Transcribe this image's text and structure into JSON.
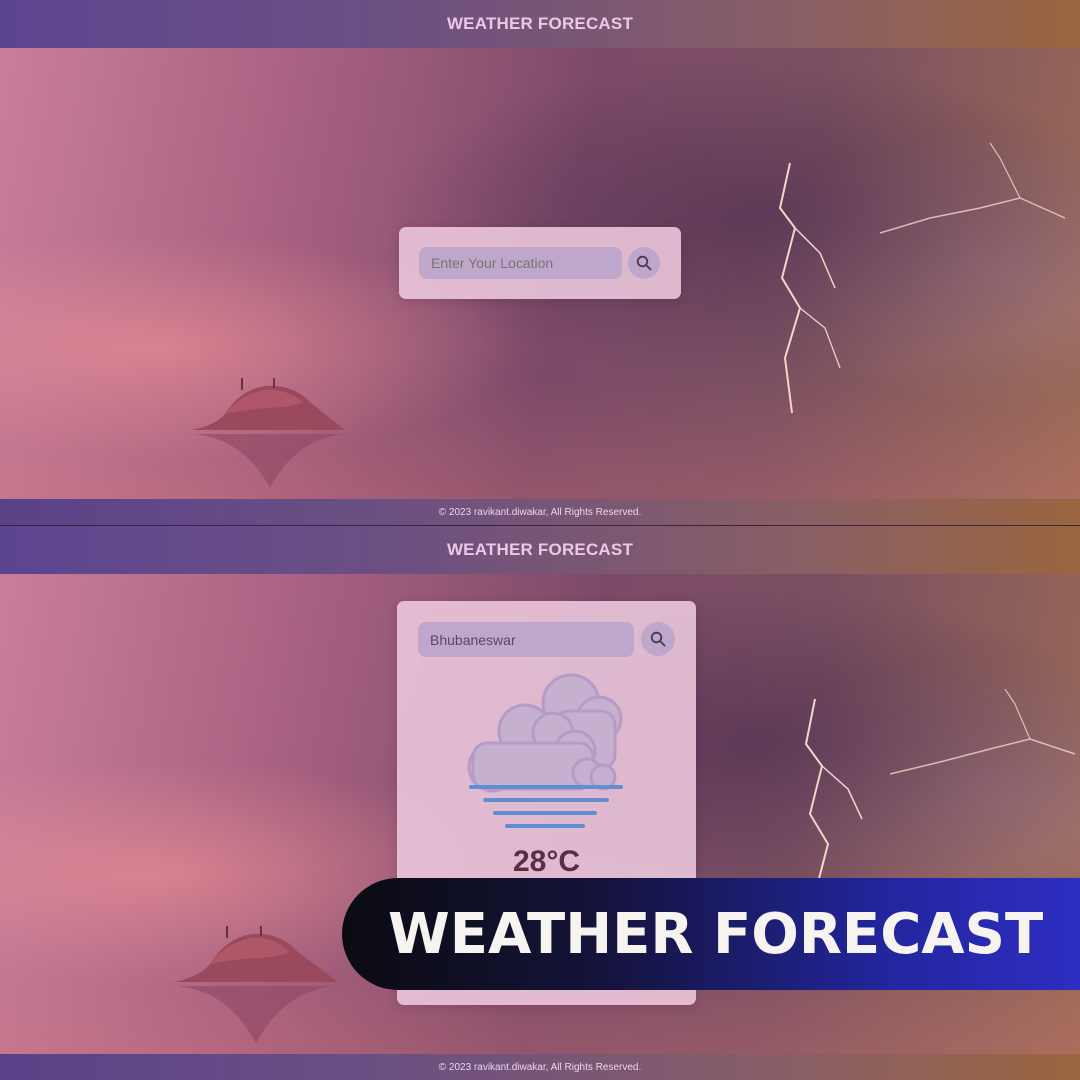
{
  "screen_top": {
    "header_title": "WEATHER FORECAST",
    "search": {
      "placeholder": "Enter Your Location"
    },
    "footer_text": "© 2023 ravikant.diwakar, All Rights Reserved."
  },
  "screen_bottom": {
    "header_title": "WEATHER FORECAST",
    "search": {
      "value": "Bhubaneswar"
    },
    "weather": {
      "icon": "cloud-fog-icon",
      "temperature": "28°C"
    },
    "footer_text": "© 2023 ravikant.diwakar, All Rights Reserved."
  },
  "banner": {
    "text": "WEATHER FORECAST"
  },
  "colors": {
    "header_start": "#5c4590",
    "header_end": "#9a6540",
    "card_bg": "#eecade",
    "field_bg": "#bfa6cb",
    "temperature": "#5a2d45",
    "fog_lines": "#5f8fcf",
    "banner_start": "#0b0b12",
    "banner_end": "#2d2ec2"
  }
}
